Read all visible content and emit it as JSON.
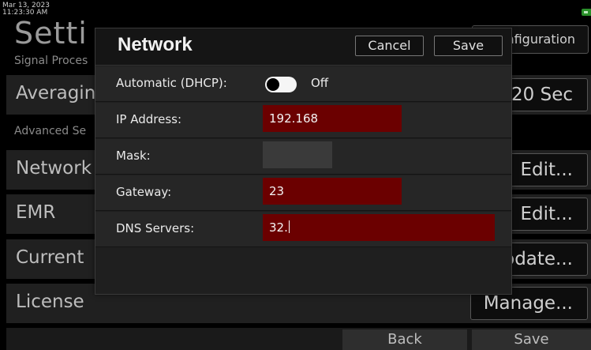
{
  "status": {
    "date": "Mar 13, 2023",
    "time": "11:23:30 AM",
    "battery_color": "#2a8f2a"
  },
  "settings": {
    "title": "Setti",
    "section_signal": "Signal Proces",
    "section_advanced": "Advanced Se",
    "configuration_button": "nfiguration",
    "rows": [
      {
        "label": "Averagin",
        "button": "20 Sec"
      },
      {
        "label": "Network",
        "button": "Edit..."
      },
      {
        "label": "EMR",
        "button": "Edit..."
      },
      {
        "label": "Current",
        "button": "odate..."
      },
      {
        "label": "License",
        "button": "Manage..."
      }
    ],
    "back_button": "Back",
    "save_button": "Save"
  },
  "dialog": {
    "title": "Network",
    "cancel_label": "Cancel",
    "save_label": "Save",
    "dhcp": {
      "label": "Automatic (DHCP):",
      "state": "Off"
    },
    "ip": {
      "label": "IP Address:",
      "value": "192.168"
    },
    "mask": {
      "label": "Mask:",
      "value": ""
    },
    "gateway": {
      "label": "Gateway:",
      "value": "23"
    },
    "dns": {
      "label": "DNS Servers:",
      "value": "32."
    },
    "invalid_color": "#6b0000"
  }
}
